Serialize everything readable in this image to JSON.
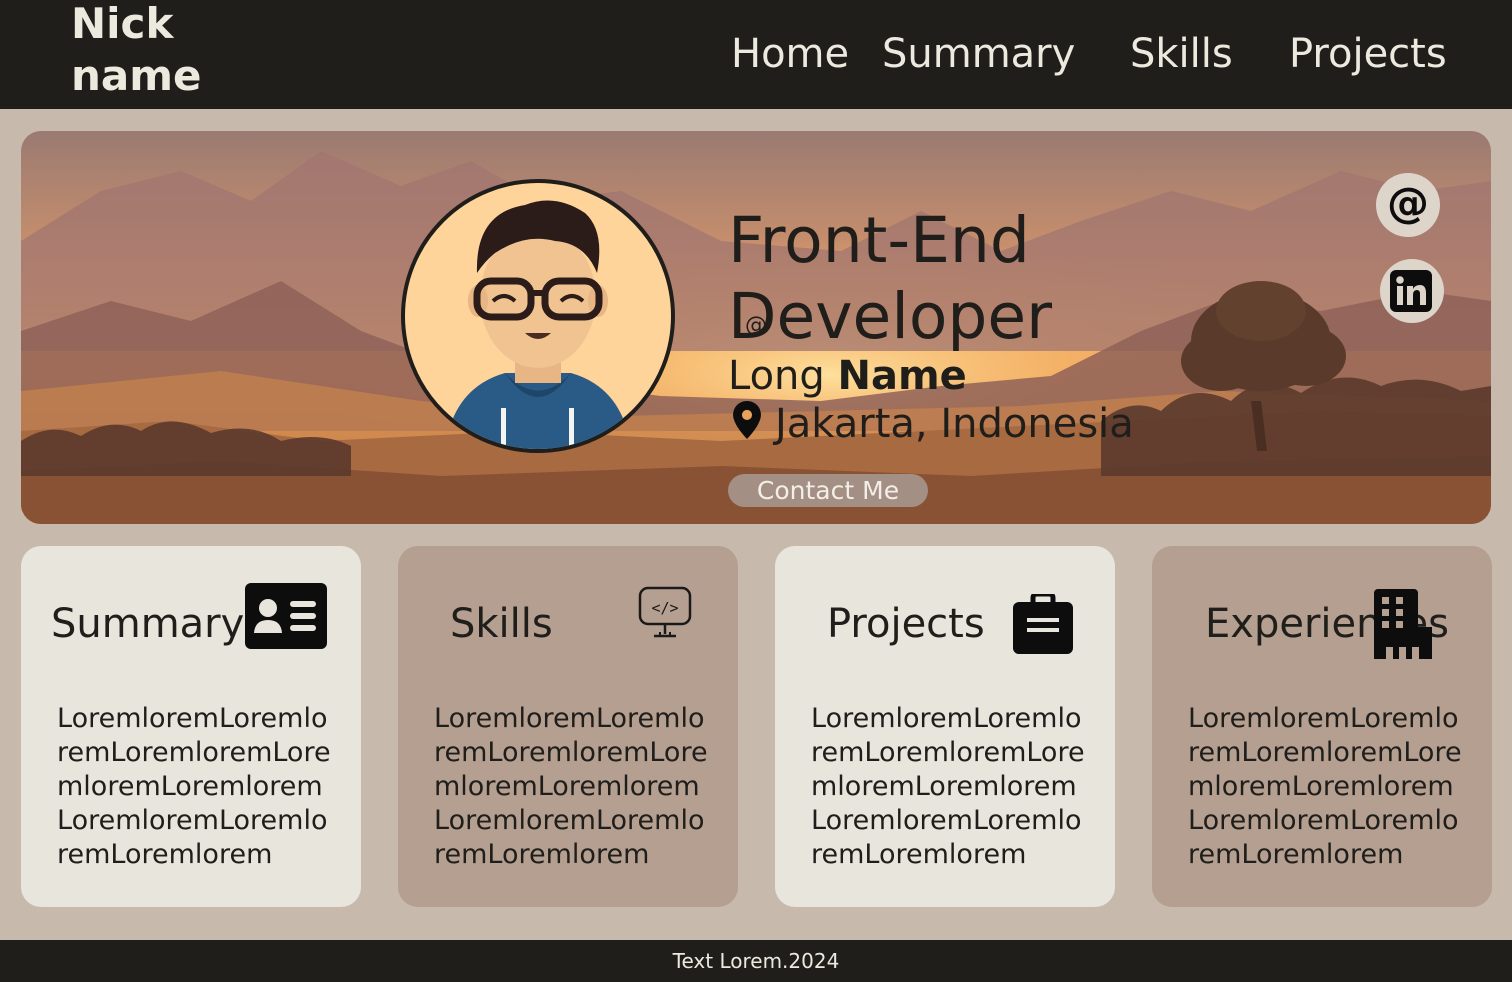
{
  "nav": {
    "brand_line1": "Nick",
    "brand_line2": "name",
    "links": [
      "Home",
      "Summary",
      "Skills",
      "Projects"
    ]
  },
  "hero": {
    "title_line1": "Front-End",
    "title_line2": "Developer",
    "name_first": "Long ",
    "name_bold": "Name",
    "location": "Jakarta, Indonesia",
    "contact_label": "Contact Me",
    "at_glyph": "@",
    "social_email_glyph": "@",
    "icons": [
      "map-pin-icon",
      "email-at-icon",
      "linkedin-icon"
    ]
  },
  "cards": [
    {
      "title": "Summary",
      "icon": "id-card-icon",
      "body": "LoremloremLoremloremLoremloremLoremloremLoremloremLoremloremLoremloremLoremlorem"
    },
    {
      "title": "Skills",
      "icon": "code-monitor-icon",
      "body": "LoremloremLoremloremLoremloremLoremloremLoremloremLoremloremLoremloremLoremlorem"
    },
    {
      "title": "Projects",
      "icon": "briefcase-icon",
      "body": "LoremloremLoremloremLoremloremLoremloremLoremloremLoremloremLoremloremLoremlorem"
    },
    {
      "title": "Experiences",
      "icon": "building-icon",
      "body": "LoremloremLoremloremLoremloremLoremloremLoremloremLoremloremLoremloremLoremlorem"
    }
  ],
  "footer": {
    "text": "Text Lorem.2024"
  },
  "colors": {
    "navbar": "#201e1b",
    "page_bg": "#c8b9ad",
    "card_light": "#e8e5dc",
    "card_dark": "#b49f91",
    "button_bg": "#a48f84"
  }
}
